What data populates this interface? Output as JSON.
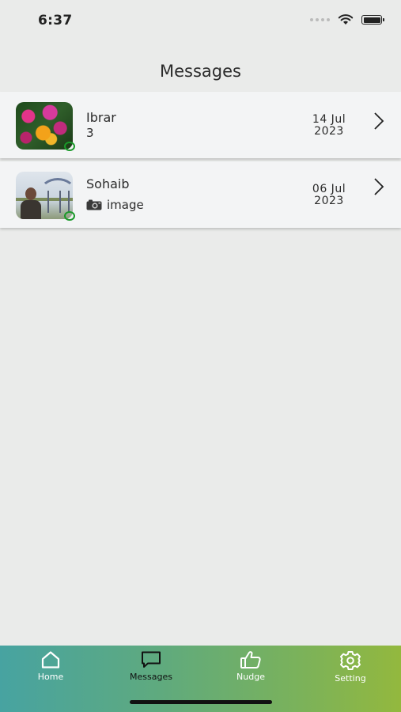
{
  "status_bar": {
    "time": "6:37"
  },
  "header": {
    "title": "Messages"
  },
  "conversations": [
    {
      "name": "Ibrar",
      "preview": "3",
      "date_line1": "14 Jul",
      "date_line2": "2023",
      "has_camera_icon": false,
      "avatar": "flowers-photo",
      "online": true
    },
    {
      "name": "Sohaib",
      "preview": "image",
      "date_line1": "06 Jul",
      "date_line2": "2023",
      "has_camera_icon": true,
      "avatar": "person-photo",
      "online": true
    }
  ],
  "tab_bar": {
    "active": "Messages",
    "tabs": [
      {
        "label": "Home",
        "icon": "home-icon"
      },
      {
        "label": "Messages",
        "icon": "chat-bubble-icon"
      },
      {
        "label": "Nudge",
        "icon": "thumbs-up-icon"
      },
      {
        "label": "Setting",
        "icon": "gear-icon"
      }
    ]
  },
  "colors": {
    "online_indicator": "#1a9a2a",
    "tab_gradient_start": "#47a3a1",
    "tab_gradient_end": "#93b83e",
    "background": "#eaebea"
  }
}
